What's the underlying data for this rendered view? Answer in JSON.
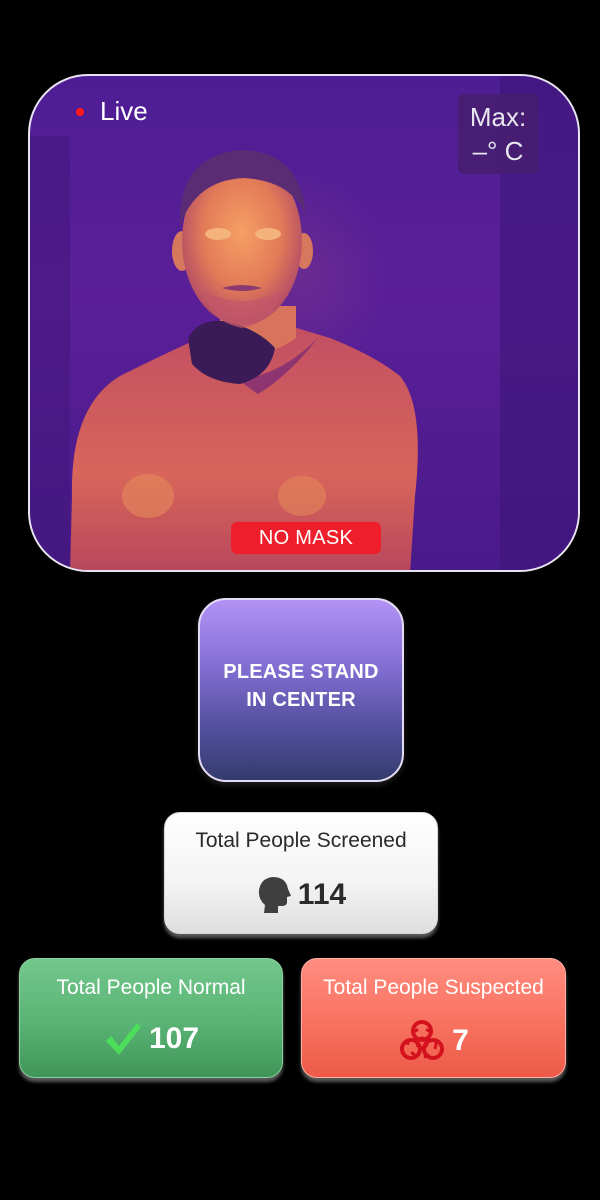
{
  "camera": {
    "live_label": "Live",
    "max_label": "Max:",
    "max_value": "–° C",
    "mask_status": "NO MASK",
    "mask_status_color": "#ee1f2a",
    "live_indicator_color": "#ff1a1a"
  },
  "instruction": {
    "line1": "PLEASE STAND",
    "line2": "IN CENTER"
  },
  "stats": {
    "screened": {
      "title": "Total People Screened",
      "value": "114",
      "icon": "head-silhouette-icon"
    },
    "normal": {
      "title": "Total People Normal",
      "value": "107",
      "icon": "checkmark-icon",
      "color": "#59b374"
    },
    "suspected": {
      "title": "Total People Suspected",
      "value": "7",
      "icon": "biohazard-icon",
      "color": "#f8715f"
    }
  }
}
